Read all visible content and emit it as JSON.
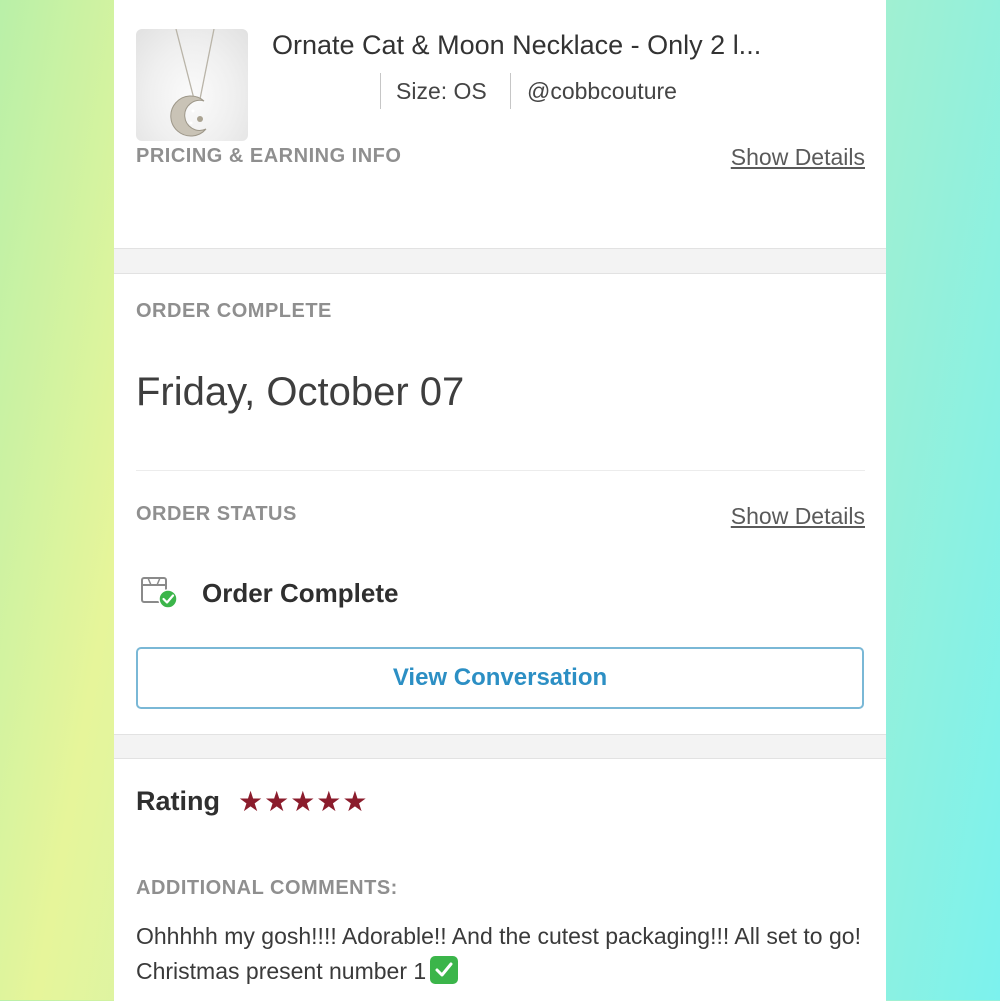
{
  "product": {
    "title": "Ornate Cat & Moon Necklace - Only 2 l...",
    "size": "Size: OS",
    "seller": "@cobbcouture"
  },
  "pricing": {
    "label": "PRICING & EARNING INFO",
    "link": "Show Details"
  },
  "order": {
    "complete_label": "ORDER COMPLETE",
    "date": "Friday, October 07",
    "status_label": "ORDER STATUS",
    "status_link": "Show Details",
    "status_text": "Order Complete",
    "view_button": "View Conversation"
  },
  "rating": {
    "label": "Rating",
    "stars": "★★★★★",
    "value": 5,
    "max": 5,
    "comments_label": "ADDITIONAL COMMENTS:",
    "comment": "Ohhhhh my gosh!!!! Adorable!! And the cutest packaging!!! All set to go! Christmas present number 1"
  },
  "icons": {
    "order_status": "box-check-icon",
    "comment_end": "check-mark-emoji-icon"
  },
  "colors": {
    "accent_blue": "#2c8fc4",
    "star_color": "#8b1c2c",
    "success_green": "#3bb54a"
  }
}
